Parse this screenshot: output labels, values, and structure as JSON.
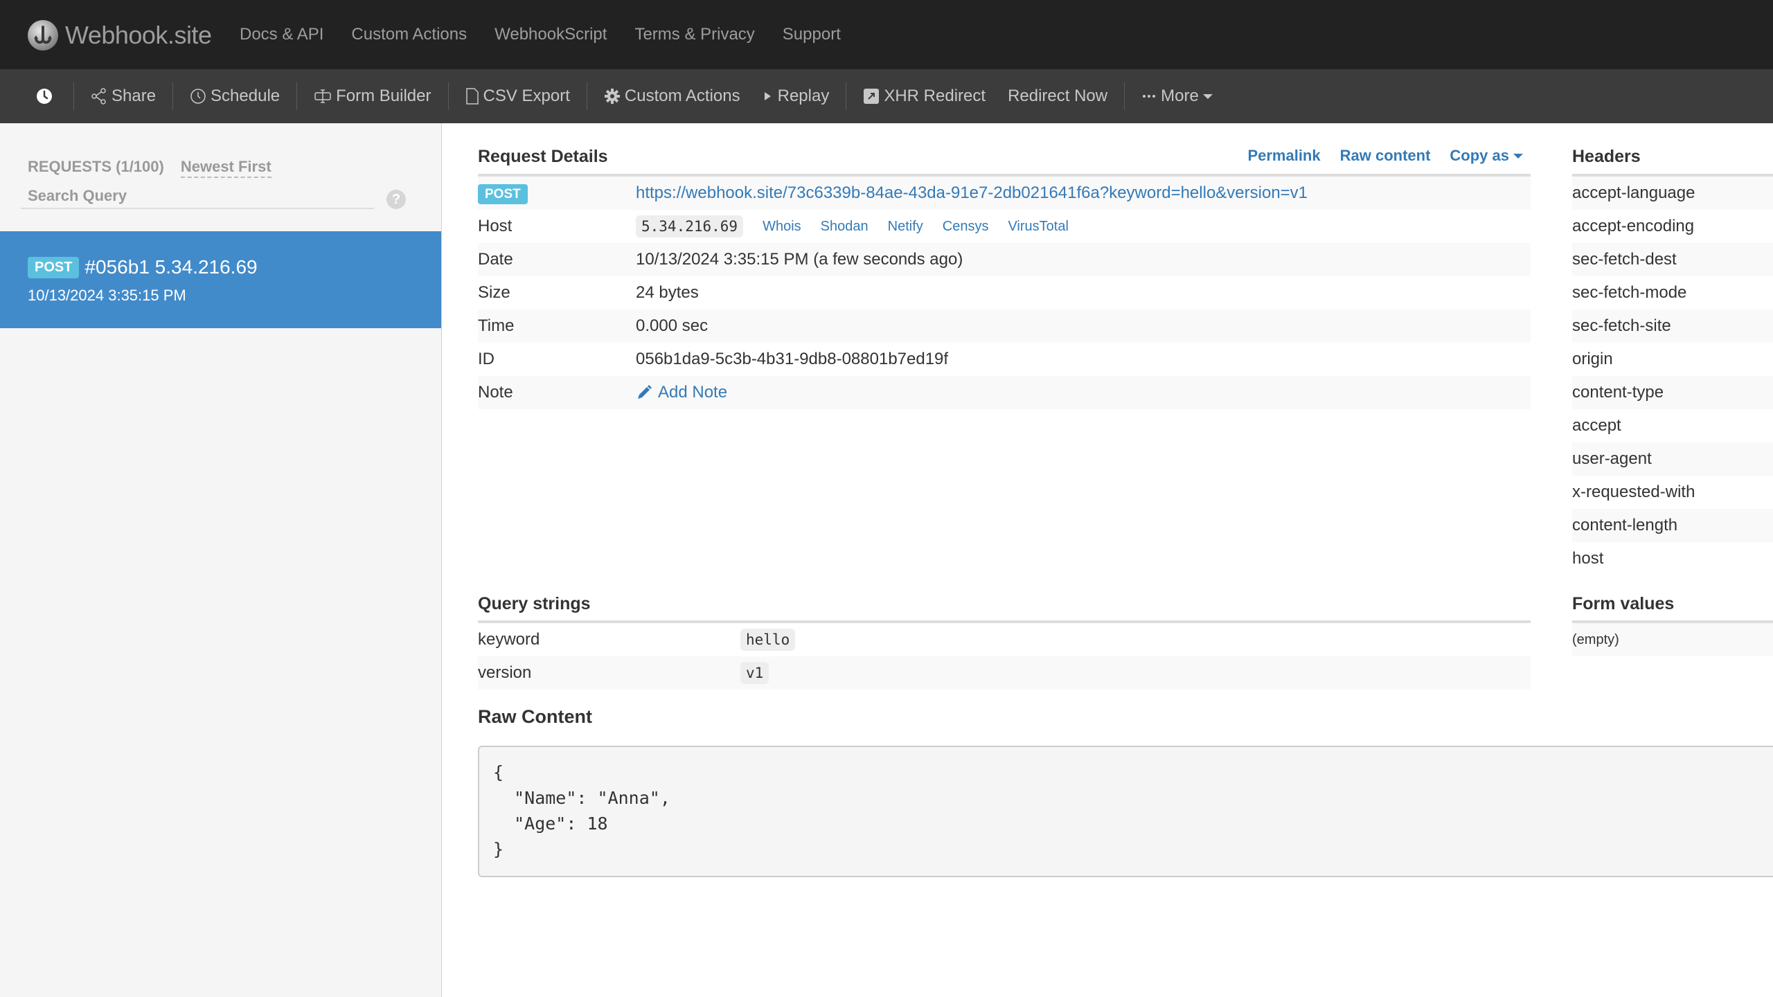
{
  "topnav": {
    "brand": "Webhook.site",
    "links": [
      "Docs & API",
      "Custom Actions",
      "WebhookScript",
      "Terms & Privacy",
      "Support"
    ]
  },
  "toolbar": {
    "history_icon": "clock-icon",
    "items": [
      {
        "label": "Share",
        "icon": "share-icon"
      },
      {
        "label": "Schedule",
        "icon": "clock-outline-icon"
      },
      {
        "label": "Form Builder",
        "icon": "form-builder-icon"
      },
      {
        "label": "CSV Export",
        "icon": "file-icon"
      },
      {
        "label": "Custom Actions",
        "icon": "gear-icon"
      },
      {
        "label": "Replay",
        "icon": "play-icon"
      },
      {
        "label": "XHR Redirect",
        "icon": "external-link-icon"
      },
      {
        "label": "Redirect Now",
        "icon": ""
      },
      {
        "label": "More",
        "icon": "ellipsis-icon"
      }
    ]
  },
  "sidebar": {
    "requests_label": "REQUESTS (1/100)",
    "sort_label": "Newest First",
    "search_placeholder": "Search Query",
    "help_label": "?",
    "requests": [
      {
        "method": "POST",
        "title": "#056b1 5.34.216.69",
        "date": "10/13/2024 3:35:15 PM"
      }
    ]
  },
  "details": {
    "title": "Request Details",
    "links": {
      "permalink": "Permalink",
      "raw_content": "Raw content",
      "copy_as": "Copy as"
    },
    "method": "POST",
    "url": "https://webhook.site/73c6339b-84ae-43da-91e7-2db021641f6a?keyword=hello&version=v1",
    "rows": {
      "host_label": "Host",
      "host_value": "5.34.216.69",
      "host_links": [
        "Whois",
        "Shodan",
        "Netify",
        "Censys",
        "VirusTotal"
      ],
      "date_label": "Date",
      "date_value": "10/13/2024 3:35:15 PM (a few seconds ago)",
      "size_label": "Size",
      "size_value": "24 bytes",
      "time_label": "Time",
      "time_value": "0.000 sec",
      "id_label": "ID",
      "id_value": "056b1da9-5c3b-4b31-9db8-08801b7ed19f",
      "note_label": "Note",
      "note_action": "Add Note"
    }
  },
  "headers": {
    "title": "Headers",
    "items": [
      "accept-language",
      "accept-encoding",
      "sec-fetch-dest",
      "sec-fetch-mode",
      "sec-fetch-site",
      "origin",
      "content-type",
      "accept",
      "user-agent",
      "x-requested-with",
      "content-length",
      "host"
    ]
  },
  "query_strings": {
    "title": "Query strings",
    "items": [
      {
        "key": "keyword",
        "value": "hello"
      },
      {
        "key": "version",
        "value": "v1"
      }
    ]
  },
  "form_values": {
    "title": "Form values",
    "empty_label": "(empty)"
  },
  "raw_content": {
    "title": "Raw Content",
    "body": "{\n  \"Name\": \"Anna\",\n  \"Age\": 18\n}"
  }
}
